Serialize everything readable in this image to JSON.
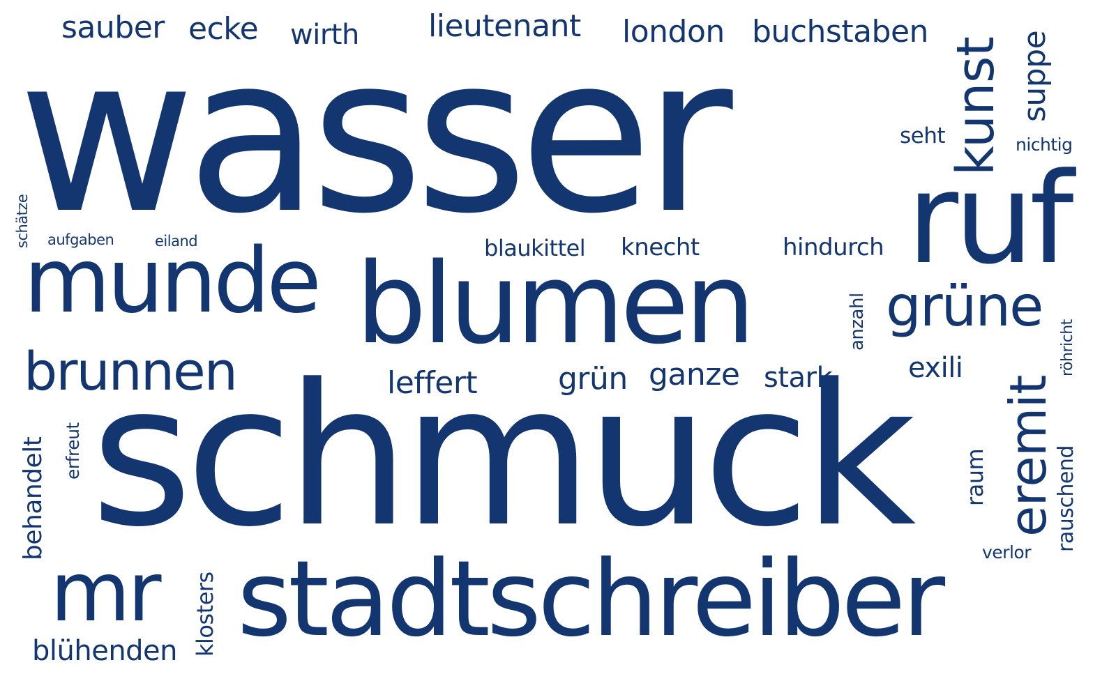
{
  "word_cloud": {
    "color": "#133670",
    "background": "#ffffff",
    "words": {
      "sauber": "sauber",
      "ecke": "ecke",
      "wirth": "wirth",
      "lieutenant": "lieutenant",
      "london": "london",
      "buchstaben": "buchstaben",
      "kunst": "kunst",
      "suppe": "suppe",
      "wasser": "wasser",
      "seht": "seht",
      "nichtig": "nichtig",
      "ruf": "ruf",
      "schaetze": "schätze",
      "aufgaben": "aufgaben",
      "eiland": "eiland",
      "blaukittel": "blaukittel",
      "knecht": "knecht",
      "hindurch": "hindurch",
      "munde": "munde",
      "blumen": "blumen",
      "gruene": "grüne",
      "anzahl": "anzahl",
      "brunnen": "brunnen",
      "exili": "exili",
      "roehricht": "röhricht",
      "leffert": "leffert",
      "gruen": "grün",
      "ganze": "ganze",
      "stark": "stark",
      "eremit": "eremit",
      "schmuck": "schmuck",
      "behandelt": "behandelt",
      "erfreut": "erfreut",
      "rauschend": "rauschend",
      "raum": "raum",
      "verlor": "verlor",
      "mr": "mr",
      "klosters": "klosters",
      "stadtschreiber": "stadtschreiber",
      "bluehenden": "blühenden"
    }
  }
}
